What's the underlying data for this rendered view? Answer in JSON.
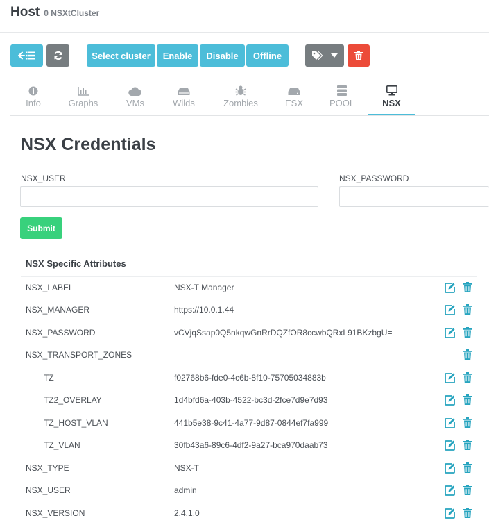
{
  "header": {
    "title": "Host",
    "subtitle": "0 NSXtCluster"
  },
  "toolbar": {
    "select_cluster": "Select cluster",
    "enable": "Enable",
    "disable": "Disable",
    "offline": "Offline"
  },
  "tabs": [
    {
      "label": "Info",
      "icon": "info-circle-icon"
    },
    {
      "label": "Graphs",
      "icon": "bar-chart-icon"
    },
    {
      "label": "VMs",
      "icon": "cloud-icon"
    },
    {
      "label": "Wilds",
      "icon": "hdd-icon"
    },
    {
      "label": "Zombies",
      "icon": "bug-icon"
    },
    {
      "label": "ESX",
      "icon": "server-icon"
    },
    {
      "label": "POOL",
      "icon": "database-icon"
    },
    {
      "label": "NSX",
      "icon": "desktop-icon"
    }
  ],
  "active_tab": "NSX",
  "credentials": {
    "heading": "NSX Credentials",
    "user_label": "NSX_USER",
    "user_value": "",
    "password_label": "NSX_PASSWORD",
    "password_value": "",
    "submit": "Submit"
  },
  "attributes": {
    "heading": "NSX Specific Attributes",
    "rows": [
      {
        "key": "NSX_LABEL",
        "value": "NSX-T Manager"
      },
      {
        "key": "NSX_MANAGER",
        "value": "https://10.0.1.44"
      },
      {
        "key": "NSX_PASSWORD",
        "value": "vCVjqSsap0Q5nkqwGnRrDQZfOR8ccwbQRxL91BKzbgU="
      },
      {
        "key": "NSX_TRANSPORT_ZONES",
        "value": ""
      },
      {
        "key": "TZ",
        "value": "f02768b6-fde0-4c6b-8f10-75705034883b"
      },
      {
        "key": "TZ2_OVERLAY",
        "value": "1d4bfd6a-403b-4522-bc3d-2fce7d9e7d93"
      },
      {
        "key": "TZ_HOST_VLAN",
        "value": "441b5e38-9c41-4a77-9d87-0844ef7fa999"
      },
      {
        "key": "TZ_VLAN",
        "value": "30fb43a6-89c6-4df2-9a27-bca970daab73"
      },
      {
        "key": "NSX_TYPE",
        "value": "NSX-T"
      },
      {
        "key": "NSX_USER",
        "value": "admin"
      },
      {
        "key": "NSX_VERSION",
        "value": "2.4.1.0"
      }
    ]
  },
  "colors": {
    "accent": "#4cbdd9",
    "success": "#38d17c",
    "danger": "#ec4b39",
    "secondary": "#777d80"
  }
}
